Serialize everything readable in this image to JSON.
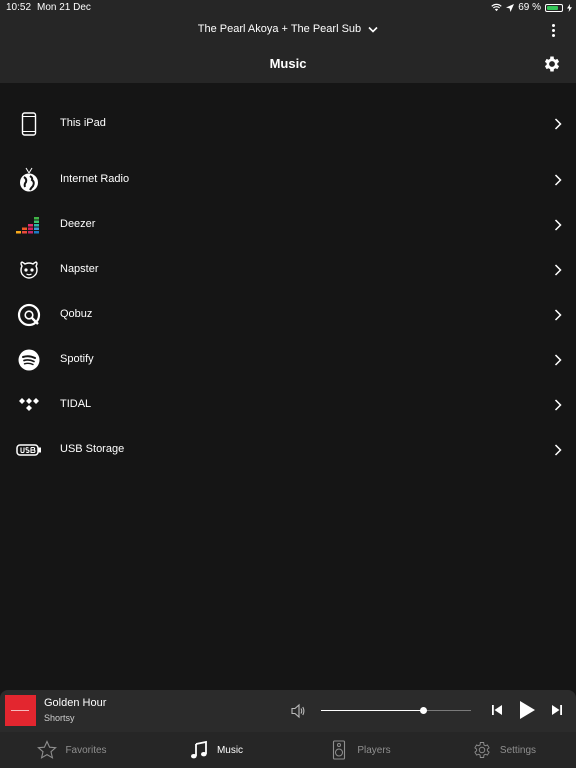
{
  "status_bar": {
    "time": "10:52",
    "date": "Mon 21 Dec",
    "battery": "69 %",
    "battery_color": "#35c759"
  },
  "header": {
    "device_selector": "The Pearl Akoya + The Pearl Sub",
    "title": "Music"
  },
  "sources": [
    {
      "label": "This iPad",
      "icon": "tablet-icon"
    },
    {
      "label": "Internet Radio",
      "icon": "globe-icon"
    },
    {
      "label": "Deezer",
      "icon": "deezer-icon"
    },
    {
      "label": "Napster",
      "icon": "napster-icon"
    },
    {
      "label": "Qobuz",
      "icon": "qobuz-icon"
    },
    {
      "label": "Spotify",
      "icon": "spotify-icon"
    },
    {
      "label": "TIDAL",
      "icon": "tidal-icon"
    },
    {
      "label": "USB Storage",
      "icon": "usb-icon"
    }
  ],
  "now_playing": {
    "title": "Golden Hour",
    "artist": "Shortsy",
    "volume_fraction": 0.68,
    "cover_color": "#e3262f"
  },
  "tabs": [
    {
      "label": "Favorites",
      "icon": "star-icon",
      "active": false
    },
    {
      "label": "Music",
      "icon": "music-note-icon",
      "active": true
    },
    {
      "label": "Players",
      "icon": "speaker-icon",
      "active": false
    },
    {
      "label": "Settings",
      "icon": "gear-icon",
      "active": false
    }
  ],
  "colors": {
    "background": "#151515",
    "bar": "#262626",
    "inactive_tab": "#8f8f8f"
  }
}
